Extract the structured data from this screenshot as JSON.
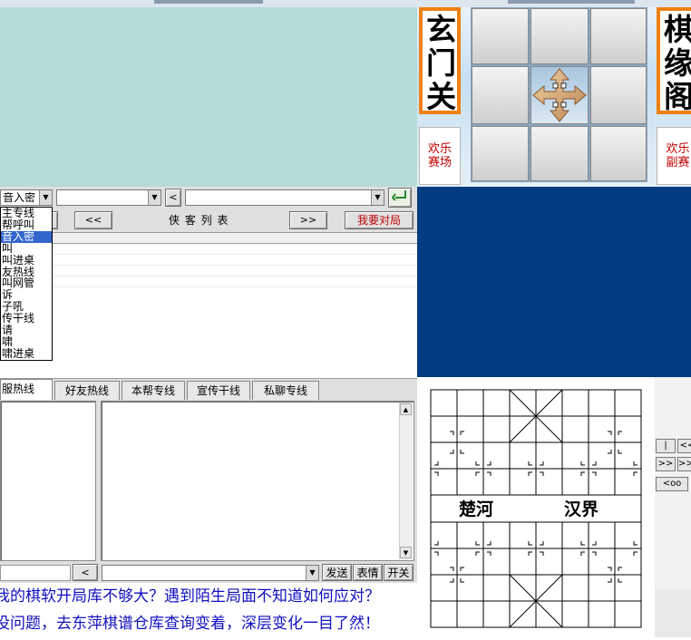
{
  "top_banner": {
    "sign_left": "玄门关",
    "sign_right": "棋缘阁",
    "btn_left": "欢乐\n赛场",
    "btn_right": "欢乐\n副赛"
  },
  "controls": {
    "mode_select_value": "音入密",
    "player_select_value": "",
    "target_select_value": "",
    "prev_label": "<",
    "confirm_icon": "enter-icon"
  },
  "list_header": {
    "prev_page": "<<",
    "title": "侠 客 列 表",
    "next_page": ">>",
    "challenge_button": "我要对局"
  },
  "channel_dropdown": {
    "items": [
      "主专线",
      "帮呼叫",
      "音入密",
      "叫",
      "叫进桌",
      "友热线",
      "叫网管",
      "诉",
      "子吼",
      "传干线",
      "请",
      "啸",
      "啸进桌"
    ],
    "selected_index": 2
  },
  "chat_tabs": [
    "服热线",
    "好友热线",
    "本帮专线",
    "宣传干线",
    "私聊专线"
  ],
  "chat_input": {
    "prev_label": "<",
    "send": "发送",
    "emote": "表情",
    "toggle": "开关"
  },
  "ticker": {
    "line1": "我的棋软开局库不够大？遇到陌生局面不知道如何应对？",
    "line2": "没问题，去东萍棋谱仓库查询变着，深层变化一目了然！"
  },
  "board": {
    "river_left": "楚河",
    "river_right": "汉界"
  },
  "move_nav": {
    "first": "|<<",
    "prev": "<<",
    "next": ">>",
    "last": ">>|",
    "extra": "<oo"
  },
  "colors": {
    "teal": "#b4dcd9",
    "navy": "#033c80",
    "orange": "#f08010",
    "ticker_blue": "#1010c0",
    "challenge_red": "#c00000"
  }
}
